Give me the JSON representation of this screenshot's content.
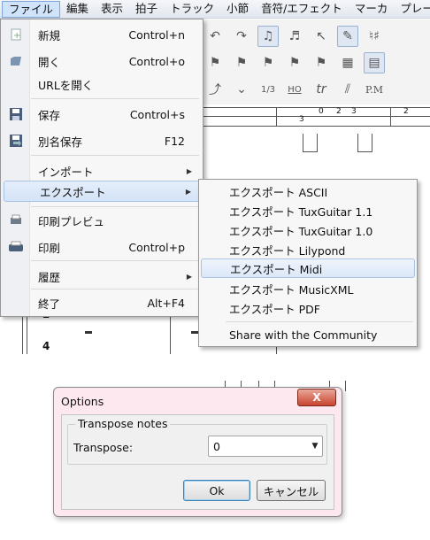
{
  "menubar": {
    "items": [
      "ファイル",
      "編集",
      "表示",
      "拍子",
      "トラック",
      "小節",
      "音符/エフェクト",
      "マーカ",
      "プレー"
    ]
  },
  "file_menu": {
    "items": [
      {
        "label": "新規",
        "shortcut": "Control+n",
        "icon": "new-file-icon"
      },
      {
        "label": "開く",
        "shortcut": "Control+o",
        "icon": "open-folder-icon"
      },
      {
        "label": "URLを開く",
        "shortcut": ""
      },
      {
        "label": "保存",
        "shortcut": "Control+s",
        "icon": "save-icon"
      },
      {
        "label": "別名保存",
        "shortcut": "F12",
        "icon": "save-as-icon"
      },
      {
        "label": "インポート",
        "shortcut": "",
        "submenu": true
      },
      {
        "label": "エクスポート",
        "shortcut": "",
        "submenu": true
      },
      {
        "label": "印刷プレビュ",
        "shortcut": "",
        "icon": "print-preview-icon"
      },
      {
        "label": "印刷",
        "shortcut": "Control+p",
        "icon": "print-icon"
      },
      {
        "label": "履歴",
        "shortcut": "",
        "submenu": true
      },
      {
        "label": "終了",
        "shortcut": "Alt+F4"
      }
    ]
  },
  "export_submenu": {
    "items": [
      "エクスポート ASCII",
      "エクスポート TuxGuitar 1.1",
      "エクスポート TuxGuitar 1.0",
      "エクスポート Lilypond",
      "エクスポート Midi",
      "エクスポート MusicXML",
      "エクスポート PDF",
      "Share with the Community"
    ]
  },
  "background": {
    "toolbar_text": [
      "1/3",
      "HO",
      "tr",
      "P.M"
    ],
    "tab_numbers": [
      "3",
      "0",
      "2",
      "3",
      "2"
    ],
    "measure_numbers": [
      "2",
      "4"
    ]
  },
  "dialog": {
    "title": "Options",
    "close_label": "X",
    "group_title": "Transpose notes",
    "transpose_label": "Transpose:",
    "transpose_value": "0",
    "ok_label": "Ok",
    "cancel_label": "キャンセル"
  }
}
